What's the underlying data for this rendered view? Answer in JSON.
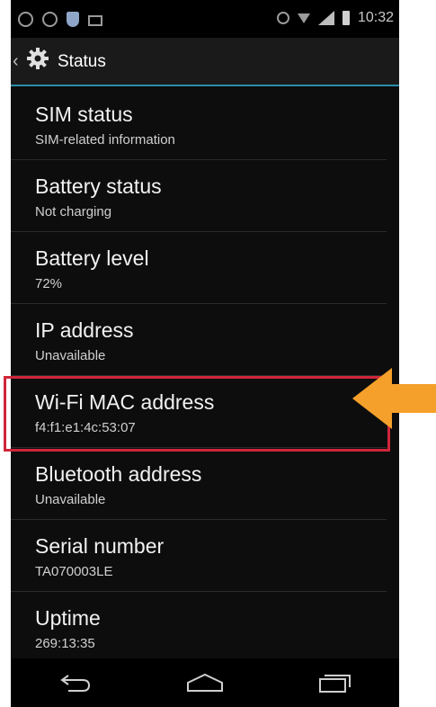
{
  "status_bar": {
    "time": "10:32",
    "icons": [
      "sync-icon",
      "at-icon",
      "shield-icon",
      "screen-icon",
      "alarm-icon",
      "wifi-icon",
      "signal-icon",
      "battery-icon"
    ]
  },
  "action_bar": {
    "title": "Status",
    "icon": "gear-icon"
  },
  "items": [
    {
      "title": "SIM status",
      "subtitle": "SIM-related information"
    },
    {
      "title": "Battery status",
      "subtitle": "Not charging"
    },
    {
      "title": "Battery level",
      "subtitle": "72%"
    },
    {
      "title": "IP address",
      "subtitle": "Unavailable"
    },
    {
      "title": "Wi-Fi MAC address",
      "subtitle": "f4:f1:e1:4c:53:07"
    },
    {
      "title": "Bluetooth address",
      "subtitle": "Unavailable"
    },
    {
      "title": "Serial number",
      "subtitle": "TA070003LE"
    },
    {
      "title": "Uptime",
      "subtitle": "269:13:35"
    }
  ],
  "annotation": {
    "highlight_color": "#d0263a",
    "arrow_color": "#f5a02a"
  },
  "nav_bar": {
    "buttons": [
      "back-icon",
      "home-icon",
      "recents-icon"
    ]
  }
}
